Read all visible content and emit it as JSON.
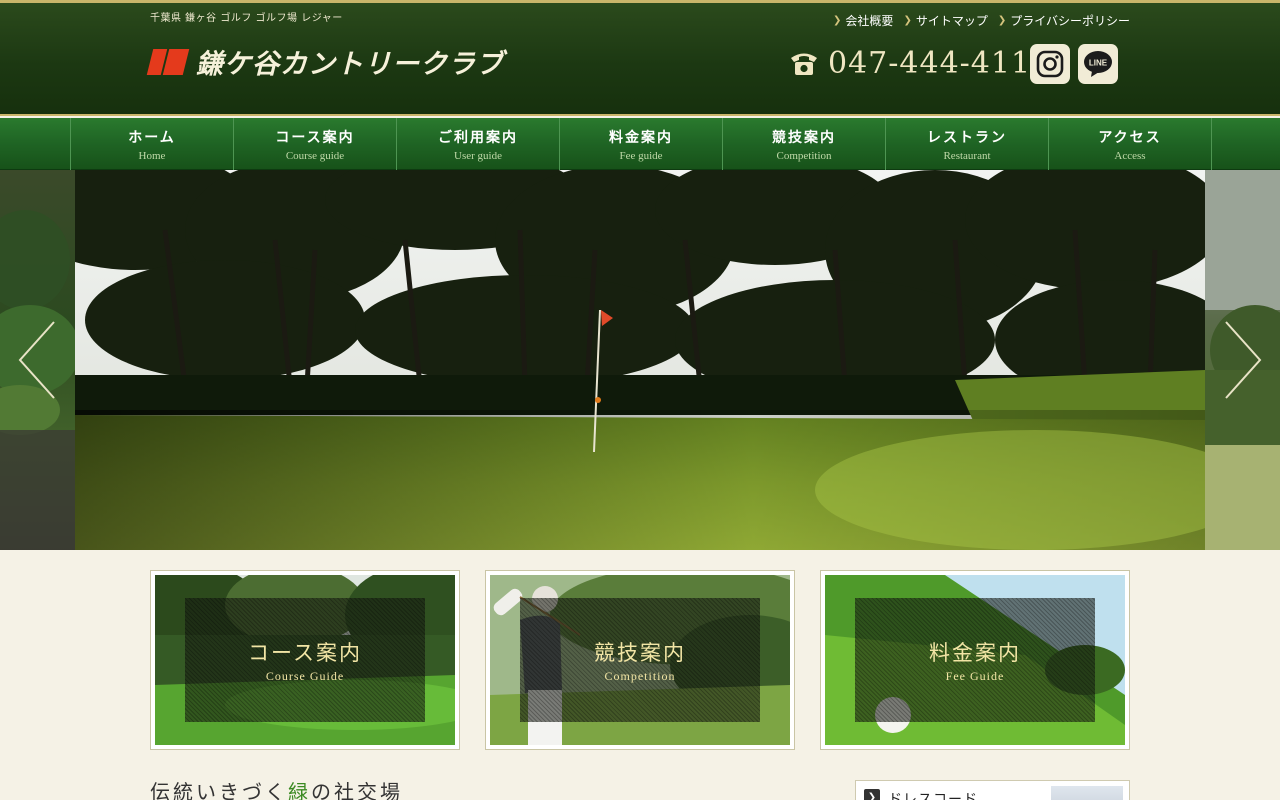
{
  "header": {
    "tagline": "千葉県 鎌ヶ谷 ゴルフ ゴルフ場 レジャー",
    "logo_text": "鎌ケ谷カントリークラブ",
    "logo_letters": "CC",
    "top_links": [
      "会社概要",
      "サイトマップ",
      "プライバシーポリシー"
    ],
    "phone": "047-444-4111",
    "sns": {
      "instagram": "instagram-icon",
      "line": "LINE"
    }
  },
  "nav": {
    "items": [
      {
        "jp": "ホーム",
        "en": "Home"
      },
      {
        "jp": "コース案内",
        "en": "Course guide"
      },
      {
        "jp": "ご利用案内",
        "en": "User guide"
      },
      {
        "jp": "料金案内",
        "en": "Fee guide"
      },
      {
        "jp": "競技案内",
        "en": "Competition"
      },
      {
        "jp": "レストラン",
        "en": "Restaurant"
      },
      {
        "jp": "アクセス",
        "en": "Access"
      }
    ]
  },
  "cards": [
    {
      "jp": "コース案内",
      "en": "Course Guide"
    },
    {
      "jp": "競技案内",
      "en": "Competition"
    },
    {
      "jp": "料金案内",
      "en": "Fee Guide"
    }
  ],
  "catch": {
    "before": "伝統いきづく",
    "accent": "緑",
    "after": "の社交場"
  },
  "dress_code": {
    "label": "ドレスコード"
  },
  "colors": {
    "header_green": "#1c3812",
    "nav_green": "#1f6424",
    "gold": "#c9b56a",
    "logo_red": "#e43a1c",
    "accent_green": "#3b8a22"
  }
}
